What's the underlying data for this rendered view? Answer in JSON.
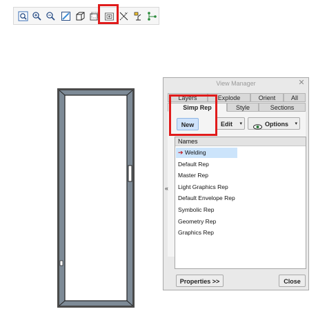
{
  "toolbar": {
    "buttons": [
      {
        "name": "refit-icon"
      },
      {
        "name": "zoom-in-icon"
      },
      {
        "name": "zoom-out-icon"
      },
      {
        "name": "repaint-icon"
      },
      {
        "name": "saved-orientations-icon"
      },
      {
        "name": "view-manager-icon",
        "highlighted": true
      },
      {
        "name": "datum-display-icon"
      },
      {
        "name": "spin-center-icon"
      },
      {
        "name": "annotation-display-icon"
      }
    ]
  },
  "view_manager": {
    "title": "View Manager",
    "close_glyph": "✕",
    "tabs_row1": [
      "Layers",
      "Explode",
      "Orient",
      "All"
    ],
    "tabs_row2": [
      "Simp Rep",
      "Style",
      "Sections"
    ],
    "active_tab": "Simp Rep",
    "new_label": "New",
    "edit_label": "Edit",
    "options_label": "Options",
    "dropdown_glyph": "▾",
    "list_header": "Names",
    "items": [
      "Welding",
      "Default Rep",
      "Master Rep",
      "Light Graphics Rep",
      "Default Envelope Rep",
      "Symbolic Rep",
      "Geometry Rep",
      "Graphics Rep"
    ],
    "selected_item": "Welding",
    "properties_label": "Properties >>",
    "close_label": "Close",
    "collapse_glyph": "«"
  },
  "colors": {
    "highlight": "#e01b1b",
    "selection": "#cce4fb",
    "frame": "#4a4a4a",
    "frame_inner": "#7d8a96"
  }
}
